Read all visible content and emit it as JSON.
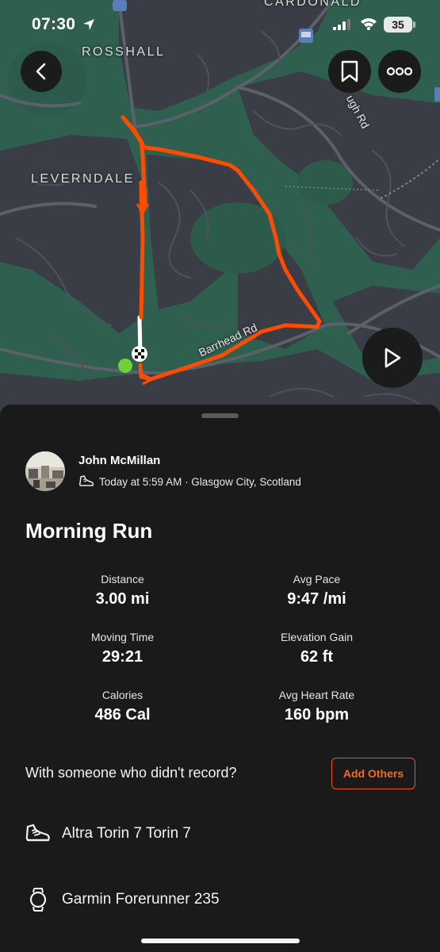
{
  "status_bar": {
    "time": "07:30",
    "battery": "35"
  },
  "map": {
    "place_labels": {
      "rosshall": "ROSSHALL",
      "cardonald": "CARDONALD",
      "leverndale": "LEVERNDALE"
    },
    "road_labels": {
      "barrhead_rd": "Barrhead Rd",
      "rd_fragment": "ugh Rd"
    },
    "route_color": "#fc4c02",
    "colors": {
      "green_space": "#2f5f4f",
      "urban": "#3a3d45",
      "roads": "#5a5e68"
    }
  },
  "activity": {
    "athlete_name": "John McMillan",
    "meta": "Today at 5:59 AM · Glasgow City, Scotland",
    "title": "Morning Run",
    "stats": [
      {
        "label": "Distance",
        "value": "3.00 mi"
      },
      {
        "label": "Avg Pace",
        "value": "9:47 /mi"
      },
      {
        "label": "Moving Time",
        "value": "29:21"
      },
      {
        "label": "Elevation Gain",
        "value": "62 ft"
      },
      {
        "label": "Calories",
        "value": "486 Cal"
      },
      {
        "label": "Avg Heart Rate",
        "value": "160 bpm"
      }
    ]
  },
  "together": {
    "text": "With someone who didn't record?",
    "button_label": "Add Others"
  },
  "gear": {
    "shoes": "Altra Torin 7 Torin 7",
    "device": "Garmin Forerunner 235"
  },
  "accent_color": "#f2550f"
}
